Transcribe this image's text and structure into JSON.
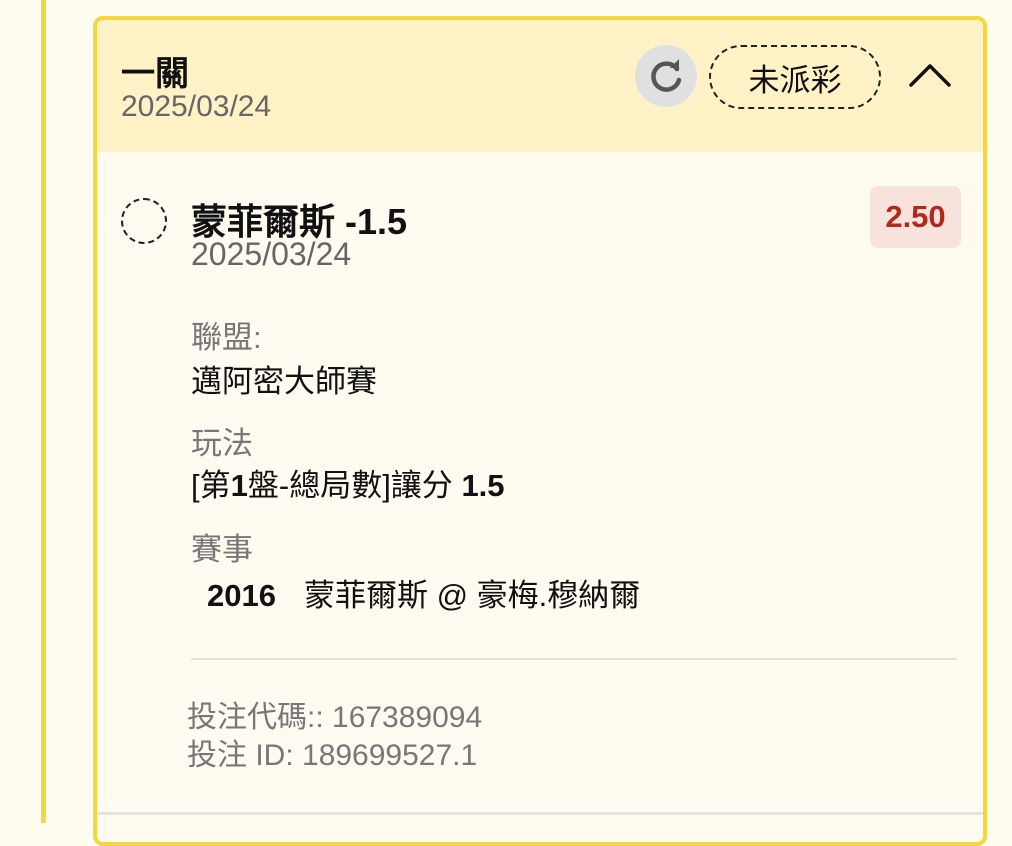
{
  "header": {
    "title": "一關",
    "date": "2025/03/24",
    "status_label": "未派彩"
  },
  "pick": {
    "title": "蒙菲爾斯 -1.5",
    "date": "2025/03/24",
    "odds": "2.50"
  },
  "details": {
    "league_label": "聯盟:",
    "league_value": "邁阿密大師賽",
    "playtype_label": "玩法",
    "playtype_value_prefix": "[第",
    "playtype_value_num": "1",
    "playtype_value_mid": "盤-總局數]讓分 ",
    "playtype_value_line": "1.5",
    "event_label": "賽事",
    "event_id": "2016",
    "event_name": "蒙菲爾斯 @ 豪梅.穆納爾"
  },
  "footer": {
    "bet_code": "投注代碼:: 167389094",
    "bet_id": "投注 ID: 189699527.1"
  },
  "colors": {
    "accent_border": "#f5d63d",
    "header_bg": "#fff2c7",
    "odds_text": "#b1281f",
    "odds_bg": "#f7e3dc"
  },
  "icons": [
    "refresh-icon",
    "chevron-up-icon"
  ]
}
